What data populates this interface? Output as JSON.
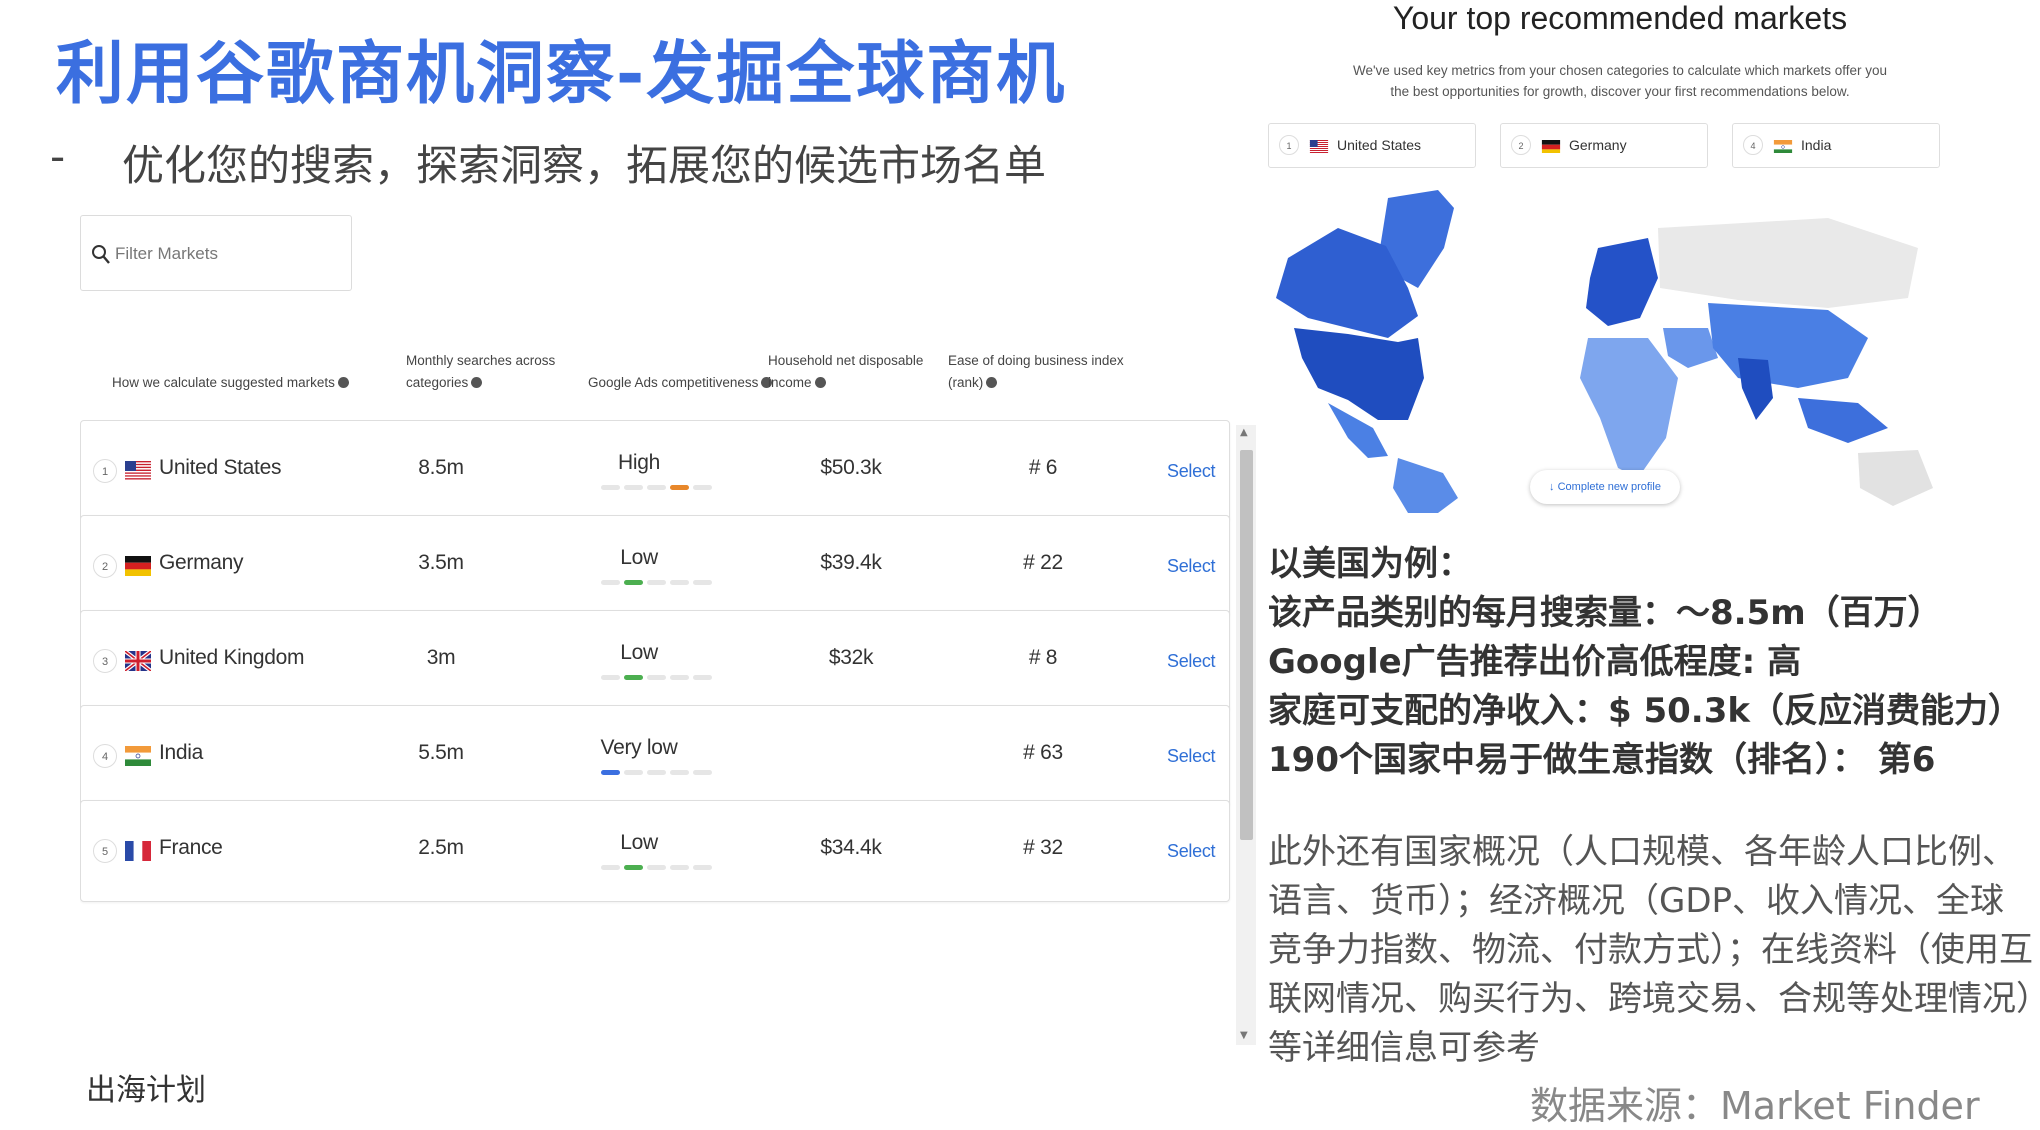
{
  "slide": {
    "title": "利用谷歌商机洞察-发掘全球商机",
    "subtitle_dash": "-",
    "subtitle": "优化您的搜索，探索洞察，拓展您的候选市场名单",
    "footer_left": "出海计划",
    "source": "数据来源：Market Finder"
  },
  "filter": {
    "placeholder": "Filter Markets"
  },
  "columns": {
    "how": "How we calculate suggested markets",
    "searches_l1": "Monthly searches across",
    "searches_l2": "categories",
    "competitiveness": "Google Ads competitiveness",
    "income_l1": "Household net disposable",
    "income_l2": "income",
    "ease_l1": "Ease of doing business index",
    "ease_l2": "(rank)"
  },
  "rows": [
    {
      "rank": "1",
      "country": "United States",
      "flag": "us",
      "searches": "8.5m",
      "competitiveness": "High",
      "level": 4,
      "level_color": "#e8872a",
      "income": "$50.3k",
      "ease": "# 6",
      "action": "Select"
    },
    {
      "rank": "2",
      "country": "Germany",
      "flag": "de",
      "searches": "3.5m",
      "competitiveness": "Low",
      "level": 2,
      "level_color": "#4caf50",
      "income": "$39.4k",
      "ease": "# 22",
      "action": "Select"
    },
    {
      "rank": "3",
      "country": "United Kingdom",
      "flag": "uk",
      "searches": "3m",
      "competitiveness": "Low",
      "level": 2,
      "level_color": "#4caf50",
      "income": "$32k",
      "ease": "# 8",
      "action": "Select"
    },
    {
      "rank": "4",
      "country": "India",
      "flag": "in",
      "searches": "5.5m",
      "competitiveness": "Very low",
      "level": 1,
      "level_color": "#3b6fe0",
      "income": "",
      "ease": "# 63",
      "action": "Select"
    },
    {
      "rank": "5",
      "country": "France",
      "flag": "fr",
      "searches": "2.5m",
      "competitiveness": "Low",
      "level": 2,
      "level_color": "#4caf50",
      "income": "$34.4k",
      "ease": "# 32",
      "action": "Select"
    }
  ],
  "recommend": {
    "title": "Your top recommended markets",
    "desc_l1": "We've used key metrics from your chosen categories to calculate which markets offer you",
    "desc_l2": "the best opportunities for growth, discover your first recommendations below.",
    "chips": [
      {
        "rank": "1",
        "country": "United States",
        "flag": "us"
      },
      {
        "rank": "2",
        "country": "Germany",
        "flag": "de"
      },
      {
        "rank": "4",
        "country": "India",
        "flag": "in"
      }
    ],
    "profile_button": "Complete new profile"
  },
  "info": {
    "l1": "以美国为例：",
    "l2": "该产品类别的每月搜索量：～8.5m（百万）",
    "l3": "Google广告推荐出价高低程度: 高",
    "l4": "家庭可支配的净收入：$ 50.3k（反应消费能力）",
    "l5": "190个国家中易于做生意指数（排名）： 第6",
    "extra": "此外还有国家概况（人口规模、各年龄人口比例、语言、货币）；经济概况（GDP、收入情况、全球竞争力指数、物流、付款方式）；在线资料（使用互联网情况、购买行为、跨境交易、合规等处理情况）等详细信息可参考"
  },
  "colors": {
    "accent": "#3b6fe0",
    "link": "#2f6fd6"
  },
  "icons": [
    "search-icon",
    "info-icon",
    "arrow-down-icon",
    "flag-icons"
  ]
}
